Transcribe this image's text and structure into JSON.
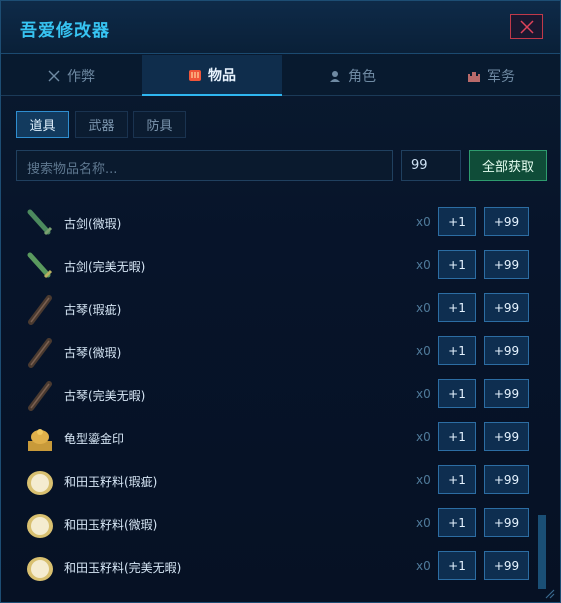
{
  "app": {
    "title": "吾爱修改器"
  },
  "tabs": [
    {
      "label": "作弊",
      "icon": "sword-icon"
    },
    {
      "label": "物品",
      "icon": "bag-icon"
    },
    {
      "label": "角色",
      "icon": "person-icon"
    },
    {
      "label": "军务",
      "icon": "castle-icon"
    }
  ],
  "subtabs": [
    "道具",
    "武器",
    "防具"
  ],
  "search": {
    "placeholder": "搜索物品名称...",
    "quantity": "99",
    "get_all_label": "全部获取"
  },
  "row_buttons": {
    "plus1": "+1",
    "plus99": "+99"
  },
  "items": [
    {
      "name": "古剑(微瑕)",
      "count": "x0",
      "icon": "ancient-sword-icon"
    },
    {
      "name": "古剑(完美无暇)",
      "count": "x0",
      "icon": "ancient-sword-icon"
    },
    {
      "name": "古琴(瑕疵)",
      "count": "x0",
      "icon": "guqin-icon"
    },
    {
      "name": "古琴(微瑕)",
      "count": "x0",
      "icon": "guqin-icon"
    },
    {
      "name": "古琴(完美无暇)",
      "count": "x0",
      "icon": "guqin-icon"
    },
    {
      "name": "龟型鎏金印",
      "count": "x0",
      "icon": "turtle-seal-icon"
    },
    {
      "name": "和田玉籽料(瑕疵)",
      "count": "x0",
      "icon": "jade-stone-icon"
    },
    {
      "name": "和田玉籽料(微瑕)",
      "count": "x0",
      "icon": "jade-stone-icon"
    },
    {
      "name": "和田玉籽料(完美无暇)",
      "count": "x0",
      "icon": "jade-stone-icon"
    }
  ],
  "colors": {
    "accent": "#37c4f2",
    "tab_active": "#2fb6f0",
    "getall_bg": "#0f4c38",
    "close_border": "#c0394a"
  }
}
